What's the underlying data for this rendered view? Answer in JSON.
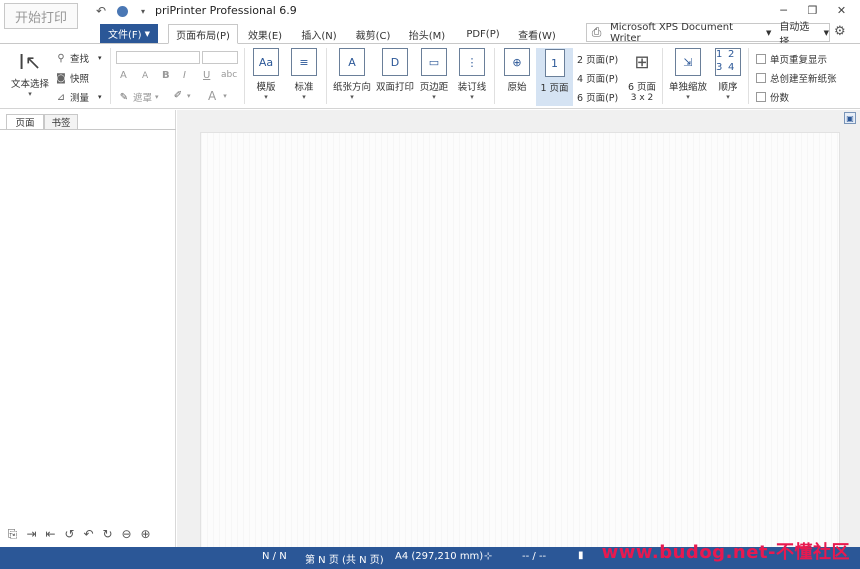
{
  "quick_access": {
    "start_print": "开始打印"
  },
  "app": {
    "title": "priPrinter Professional 6.9"
  },
  "tabs": [
    {
      "label": "文件(F)"
    },
    {
      "label": "页面布局(P)"
    },
    {
      "label": "效果(E)"
    },
    {
      "label": "插入(N)"
    },
    {
      "label": "裁剪(C)"
    },
    {
      "label": "抬头(M)"
    },
    {
      "label": "PDF(P)"
    },
    {
      "label": "查看(W)"
    }
  ],
  "printer": {
    "name": "Microsoft XPS Document Writer",
    "mode": "自动选择"
  },
  "ribbon": {
    "text_select": "文本选择",
    "find": "查找",
    "snapshot": "快照",
    "measure": "测量",
    "font_grow": "A",
    "font_shrink": "A",
    "bold": "B",
    "italic": "I",
    "underline": "U",
    "strike": "abc",
    "redact": "遮罩",
    "color_a": "A",
    "template": "模版",
    "header_mark": "标准",
    "orientation": "纸张方向",
    "duplex": "双面打印",
    "margins": "页边距",
    "binding": "装订线",
    "original": "原始",
    "one_page": "1 页面",
    "two_pages": "2 页面(P)",
    "four_pages": "4 页面(P)",
    "six_pages_p": "6 页面(P)",
    "six_pages": "6 页面",
    "grid_3x2": "3 x 2",
    "single_zoom": "单独缩放",
    "order": "顺序",
    "repeat_single": "单页重复显示",
    "always_new_sheet": "总创建至新纸张",
    "copies": "份数"
  },
  "left_panel": {
    "tab_pages": "页面",
    "tab_bookmarks": "书签"
  },
  "status": {
    "page_index": "N / N",
    "page_info": "第 N 页 (共 N 页)",
    "paper": "A4 (297,210 mm)",
    "coords": "-- / --"
  },
  "watermark": "www.budog.net-不懂社区"
}
